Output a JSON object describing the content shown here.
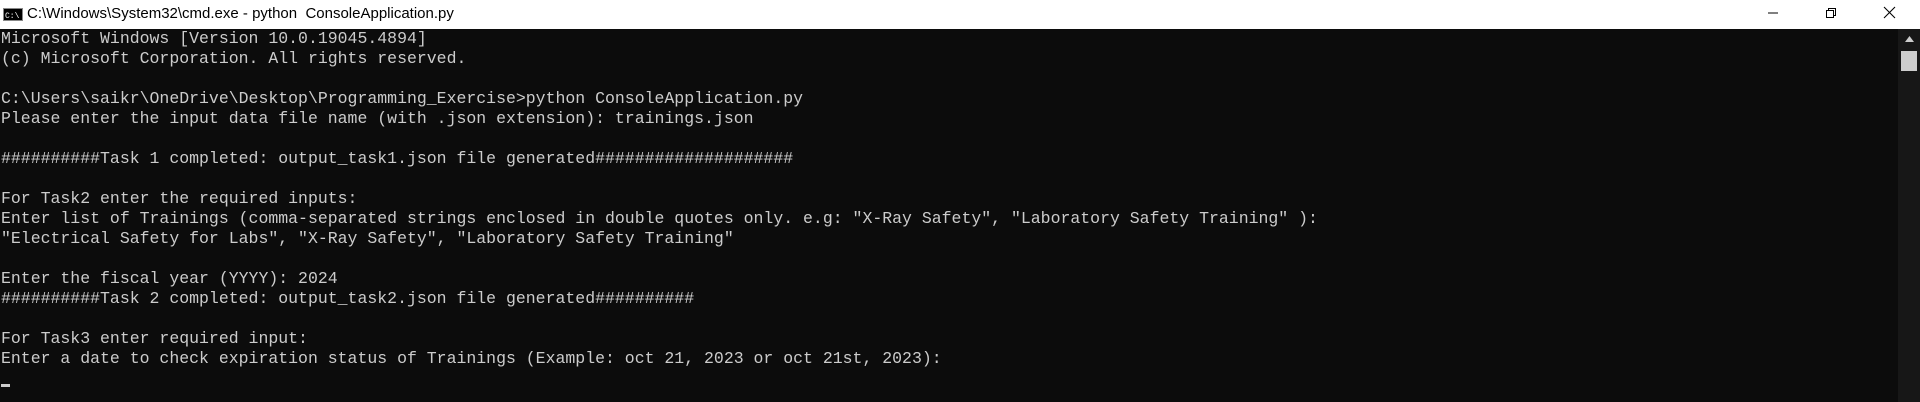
{
  "window": {
    "title": "C:\\Windows\\System32\\cmd.exe - python  ConsoleApplication.py",
    "app_icon": "cmd-icon",
    "controls": {
      "minimize_icon": "minimize-icon",
      "maximize_icon": "restore-icon",
      "close_icon": "close-icon"
    }
  },
  "console": {
    "lines": [
      "Microsoft Windows [Version 10.0.19045.4894]",
      "(c) Microsoft Corporation. All rights reserved.",
      "",
      "C:\\Users\\saikr\\OneDrive\\Desktop\\Programming_Exercise>python ConsoleApplication.py",
      "Please enter the input data file name (with .json extension): trainings.json",
      "",
      "##########Task 1 completed: output_task1.json file generated####################",
      "",
      "For Task2 enter the required inputs:",
      "Enter list of Trainings (comma-separated strings enclosed in double quotes only. e.g: \"X-Ray Safety\", \"Laboratory Safety Training\" ):",
      "\"Electrical Safety for Labs\", \"X-Ray Safety\", \"Laboratory Safety Training\"",
      "",
      "Enter the fiscal year (YYYY): 2024",
      "##########Task 2 completed: output_task2.json file generated##########",
      "",
      "For Task3 enter required input:",
      "Enter a date to check expiration status of Trainings (Example: oct 21, 2023 or oct 21st, 2023):"
    ]
  },
  "colors": {
    "background": "#0c0c0c",
    "text": "#cccccc",
    "titlebar": "#ffffff"
  }
}
